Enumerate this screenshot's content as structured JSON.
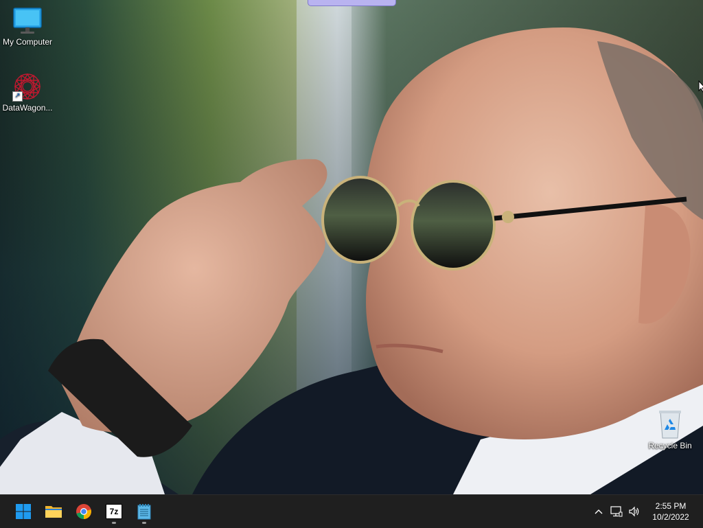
{
  "desktop": {
    "icons": [
      {
        "label": "My Computer",
        "icon": "monitor-icon"
      },
      {
        "label": "DataWagon...",
        "icon": "datawagon-logo-icon"
      },
      {
        "label": "Recycle Bin",
        "icon": "recycle-bin-icon"
      }
    ]
  },
  "taskbar": {
    "apps": [
      {
        "name": "Start",
        "icon": "windows-start-icon"
      },
      {
        "name": "File Explorer",
        "icon": "folder-icon"
      },
      {
        "name": "Google Chrome",
        "icon": "chrome-icon"
      },
      {
        "name": "7-Zip",
        "icon": "7zip-icon",
        "glyph_text": "7z"
      },
      {
        "name": "Notepad",
        "icon": "notepad-icon"
      }
    ],
    "tray": {
      "icons": [
        "chevron-up-icon",
        "network-icon",
        "volume-icon"
      ]
    },
    "clock": {
      "time": "2:55 PM",
      "date": "10/2/2022"
    }
  },
  "colors": {
    "taskbar_bg": "#1f1f1f",
    "start_blue": "#1f9bf0",
    "snap_handle": "#b9b3f0"
  }
}
